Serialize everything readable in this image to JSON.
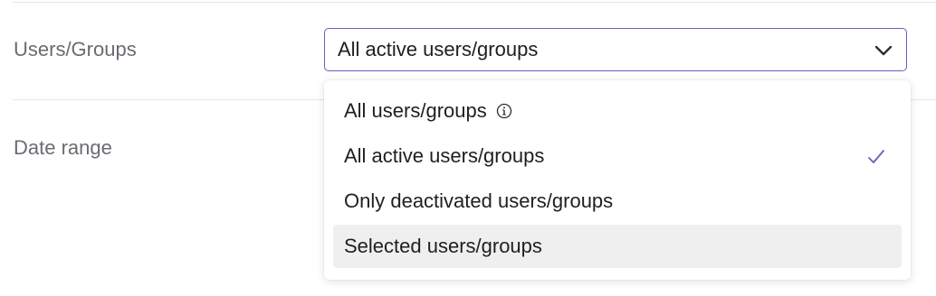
{
  "filters": {
    "users_groups": {
      "label": "Users/Groups",
      "selected_value": "All active users/groups",
      "icon": "chevron-down-icon",
      "accent_color": "#6a5cc5"
    },
    "date_range": {
      "label": "Date range"
    }
  },
  "dropdown": {
    "options": [
      {
        "label": "All users/groups",
        "icon": "info-icon"
      },
      {
        "label": "All active users/groups",
        "selected": true,
        "icon": "check-icon"
      },
      {
        "label": "Only deactivated users/groups"
      },
      {
        "label": "Selected users/groups",
        "highlighted": true
      }
    ]
  }
}
